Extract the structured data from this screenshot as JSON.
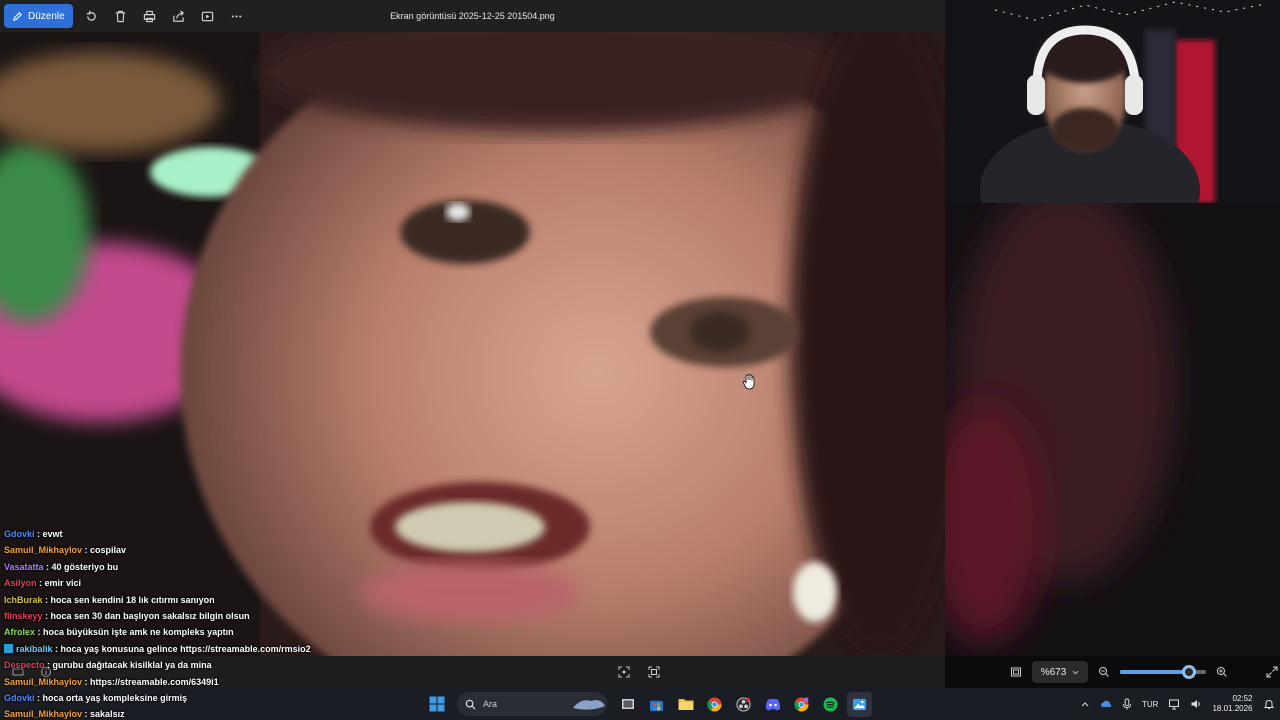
{
  "viewer": {
    "edit_label": "Düzenle",
    "file_name": "Ekran görüntüsü 2025-12-25 201504.png",
    "toolbar_icons": [
      "rotate-icon",
      "delete-icon",
      "print-icon",
      "share-icon",
      "slideshow-icon",
      "more-icon"
    ],
    "zoom_level": "%673",
    "zoom_fraction": 0.8
  },
  "chat": {
    "messages": [
      {
        "user": "Gdovki",
        "text": ": evwt",
        "color": "#4a8cff"
      },
      {
        "user": "Samuil_Mikhaylov",
        "text": ": cospilav",
        "color": "#f2a23a"
      },
      {
        "user": "Vasatatta",
        "text": ": 40 gösteriyo bu",
        "color": "#b07cff"
      },
      {
        "user": "Asilyon",
        "text": ": emir vici",
        "color": "#e0405a"
      },
      {
        "user": "IchBurak",
        "text": ": hoca sen kendini 18 lık cıtırmı sanıyon",
        "color": "#d6c53a"
      },
      {
        "user": "flinskeyy",
        "text": ": hoca sen 30 dan başlıyon sakalsız bilgin olsun",
        "color": "#e0405a"
      },
      {
        "user": "Afrolex",
        "text": ": hoca büyüksün işte amk ne kompleks yaptın",
        "color": "#8fe05a"
      },
      {
        "user": "rakibalik",
        "text": ": hoca yaş konusuna gelince https://streamable.com/rmsio2",
        "color": "#6ad0ff",
        "badge": true
      },
      {
        "user": "Despecto",
        "text": ": gurubu dağıtacak kisilklal ya da mina",
        "color": "#e0405a"
      },
      {
        "user": "Samuil_Mikhaylov",
        "text": ": https://streamable.com/6349i1",
        "color": "#f2a23a"
      },
      {
        "user": "Gdovki",
        "text": ": hoca orta yaş kompleksine girmiş",
        "color": "#4a8cff"
      },
      {
        "user": "Samuil_Mikhaylov",
        "text": ": sakalsız",
        "color": "#f2a23a"
      }
    ]
  },
  "taskbar": {
    "search_placeholder": "Ara",
    "apps": [
      "windows-start-icon",
      "task-view-icon",
      "store-icon",
      "file-explorer-icon",
      "chrome-icon",
      "obs-icon",
      "discord-icon",
      "chrome-alt-icon",
      "spotify-icon",
      "photos-icon"
    ],
    "language": "TUR",
    "time": "02:52",
    "date": "18.01.2026"
  },
  "colors": {
    "accent": "#2f6fd8",
    "toolbar_bg": "#202020",
    "taskbar_bg": "#1b1d24"
  }
}
